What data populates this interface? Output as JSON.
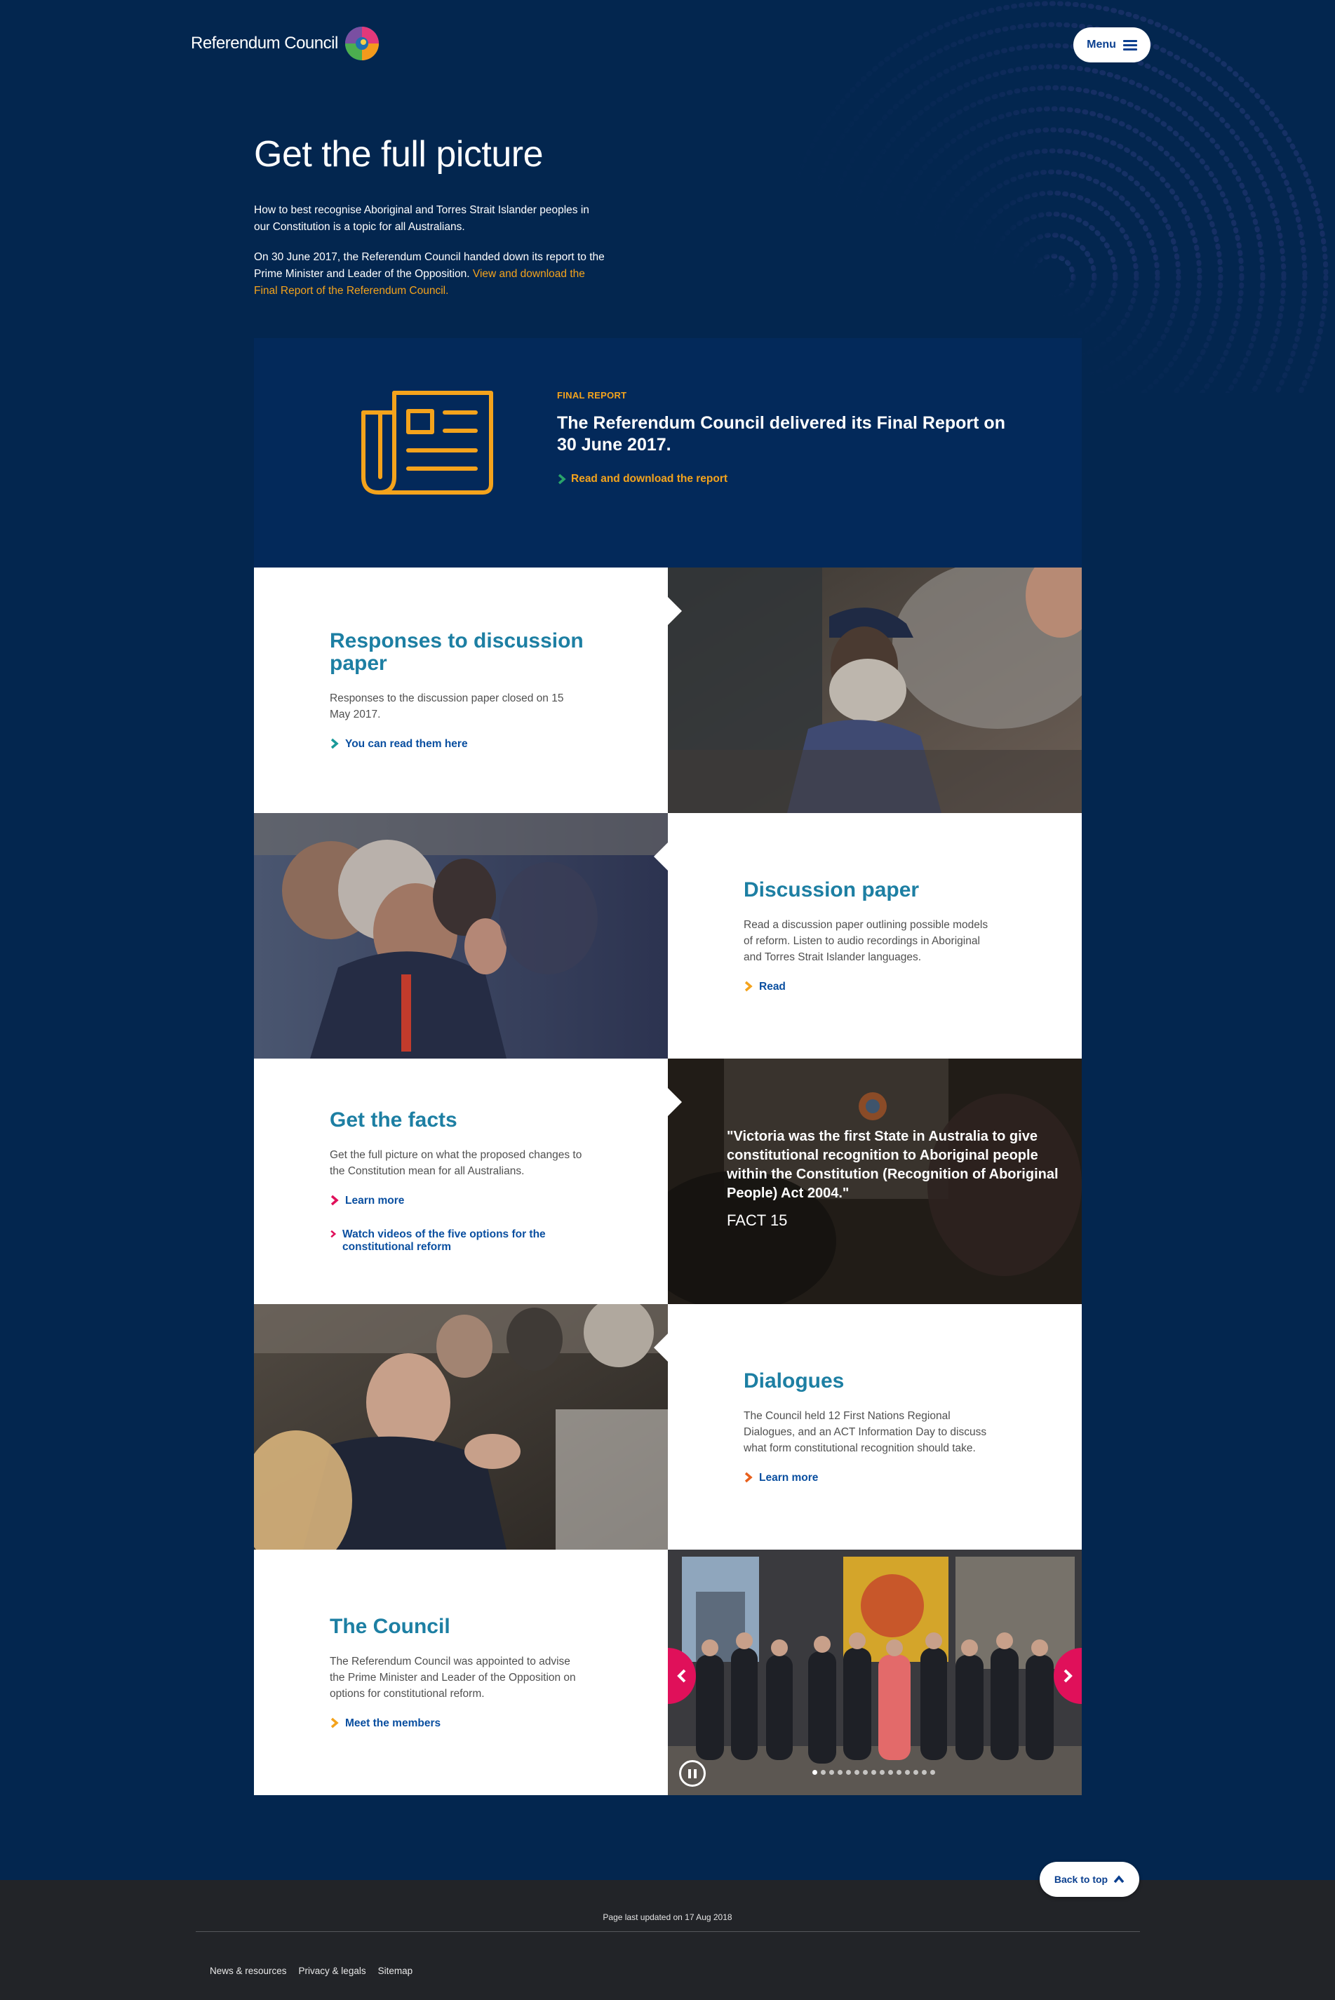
{
  "header": {
    "brand": "Referendum Council",
    "menu_label": "Menu"
  },
  "intro": {
    "title": "Get the full picture",
    "p1": "How to best recognise Aboriginal and Torres Strait Islander peoples in our Constitution is a topic for all Australians.",
    "p2_text": "On 30 June 2017, the Referendum Council handed down its report to the Prime Minister and Leader of the Opposition. ",
    "p2_link": "View and download the Final Report of the Referendum Council."
  },
  "final_report": {
    "eyebrow": "FINAL REPORT",
    "title": "The Referendum Council delivered its Final Report on 30 June 2017.",
    "link": "Read and download the report"
  },
  "cards": {
    "responses": {
      "title": "Responses to discussion paper",
      "text": "Responses to the discussion paper closed on 15 May 2017.",
      "link": "You can read them here"
    },
    "discussion": {
      "title": "Discussion paper",
      "text": "Read a discussion paper outlining possible models of reform. Listen to audio recordings in Aboriginal and Torres Strait Islander languages.",
      "link": "Read"
    },
    "facts": {
      "title": "Get the facts",
      "text": "Get the full picture on what the proposed changes to the Constitution mean for all Australians.",
      "link1": "Learn more",
      "link2": "Watch videos of the five options for the constitutional reform",
      "quote": "\"Victoria was the first State in Australia to give constitutional recognition to Aboriginal people within the Constitution (Recognition of Aboriginal People) Act 2004.\"",
      "fact_label": "FACT 15"
    },
    "dialogues": {
      "title": "Dialogues",
      "text": "The Council held 12 First Nations Regional Dialogues, and an ACT Information Day to discuss what form constitutional recognition should take.",
      "link": "Learn more"
    },
    "council": {
      "title": "The Council",
      "text": "The Referendum Council was appointed to advise the Prime Minister and Leader of the Opposition on options for constitutional reform.",
      "link": "Meet the members"
    }
  },
  "carousel": {
    "slide_count": 15,
    "active_index": 0
  },
  "footer": {
    "back_to_top": "Back to top",
    "updated": "Page last updated on 17 Aug 2018",
    "links": [
      "News & resources",
      "Privacy & legals",
      "Sitemap"
    ]
  },
  "colors": {
    "navy": "#03264f",
    "accent_orange": "#f4a31c",
    "heading_teal": "#1d7fa3",
    "link_blue": "#0a4fa0",
    "pink": "#e0105a",
    "green_chevron": "#2aa36a",
    "footer": "#222428"
  }
}
